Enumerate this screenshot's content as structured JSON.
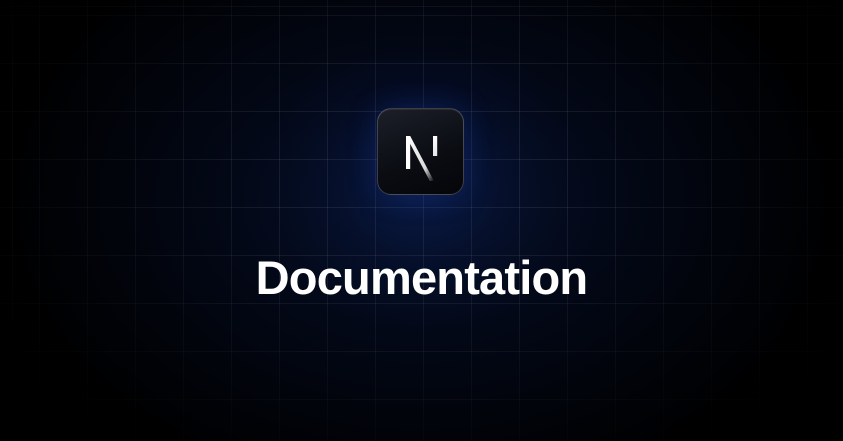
{
  "heading": "Documentation",
  "logo": {
    "icon": "nextjs-n-logo-icon",
    "letter": "N"
  },
  "colors": {
    "background": "#000000",
    "glow": "#06122e",
    "text": "#ffffff"
  }
}
